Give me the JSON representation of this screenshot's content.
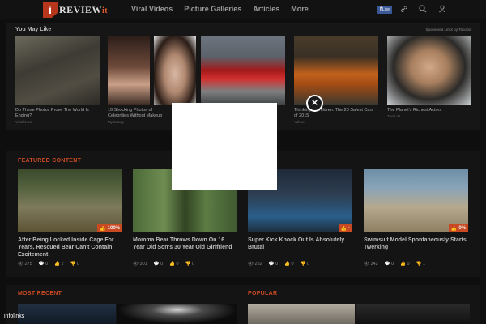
{
  "header": {
    "logo_mark": "i",
    "logo_text": "REVIEW",
    "logo_suffix": "it",
    "nav": [
      "Viral Videos",
      "Picture Galleries",
      "Articles",
      "More"
    ],
    "fb_label": "Like",
    "icons": [
      "facebook-icon",
      "link-icon",
      "search-icon",
      "user-icon"
    ]
  },
  "you_may_like": {
    "title": "You May Like",
    "sponsor": "Sponsored Links by Taboola",
    "cards": [
      {
        "title": "Do These Photos Prove The World Is Ending?",
        "source": "Viral Nova"
      },
      {
        "title": "10 Shocking Photos of Celebrities Without Makeup",
        "source": "MyBeauty"
      },
      {
        "title": "",
        "source": ""
      },
      {
        "title": "Thinking of children: The 20 Safest Cars of 2015",
        "source": "Yahoo"
      },
      {
        "title": "The Planet's Richest Actors",
        "source": "The List"
      }
    ]
  },
  "featured": {
    "title": "FEATURED CONTENT",
    "items": [
      {
        "title": "After Being Locked Inside Cage For Years, Rescued Bear Can't Contain Excitement",
        "badge": "100%",
        "views": "275",
        "comments": "0",
        "likes": "2",
        "dislikes": "0"
      },
      {
        "title": "Momma Bear Throws Down On 16 Year Old Son's 30 Year Old Girlfriend",
        "badge": "",
        "views": "301",
        "comments": "0",
        "likes": "0",
        "dislikes": "0"
      },
      {
        "title": "Super Kick Knock Out Is Absolutely Brutal",
        "badge": "-",
        "views": "252",
        "comments": "0",
        "likes": "0",
        "dislikes": "0"
      },
      {
        "title": "Swimsuit Model Spontaneously Starts Twerking",
        "badge": "0%",
        "views": "342",
        "comments": "0",
        "likes": "0",
        "dislikes": "1"
      }
    ]
  },
  "most_recent": {
    "title": "MOST RECENT"
  },
  "popular": {
    "title": "POPULAR"
  },
  "overlay": {
    "close_label": "×"
  },
  "footer": {
    "infolinks": "infolinks"
  },
  "colors": {
    "accent": "#c94a22",
    "background": "#0e0e0e",
    "fb_blue": "#3b5998"
  }
}
